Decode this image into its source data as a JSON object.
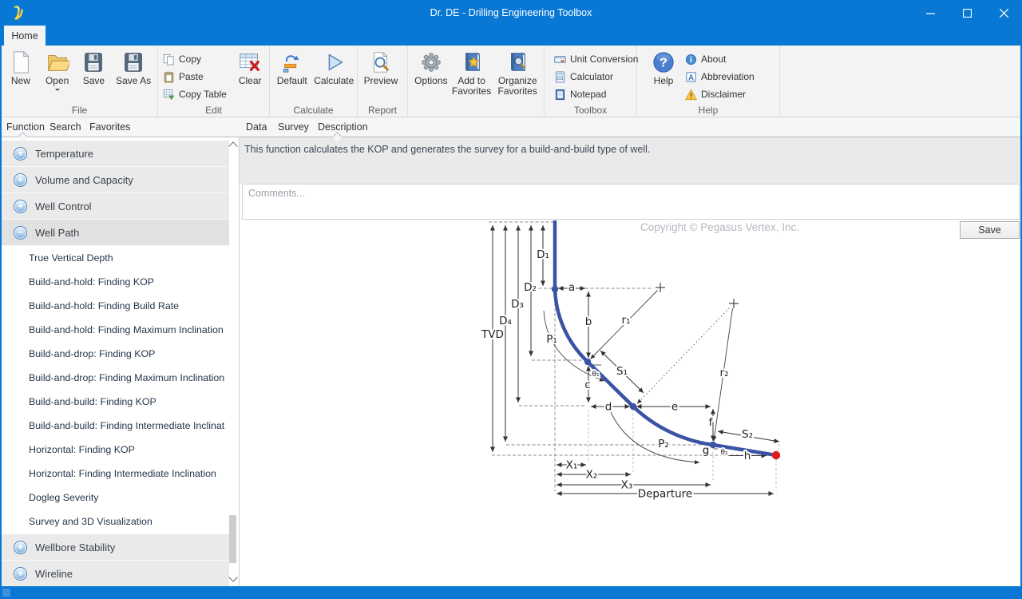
{
  "titlebar": {
    "title": "Dr. DE - Drilling Engineering Toolbox"
  },
  "ribbon": {
    "home_tab": "Home",
    "file": {
      "group": "File",
      "new": "New",
      "open": "Open",
      "save": "Save",
      "save_as": "Save As"
    },
    "edit": {
      "group": "Edit",
      "copy": "Copy",
      "paste": "Paste",
      "copy_table": "Copy Table",
      "clear": "Clear"
    },
    "calc": {
      "group": "Calculate",
      "default": "Default",
      "calculate": "Calculate"
    },
    "report": {
      "group": "Report",
      "preview": "Preview"
    },
    "favorites": {
      "options": "Options",
      "add_to_favorites": "Add to Favorites",
      "organize_favorites": "Organize Favorites"
    },
    "toolbox": {
      "group": "Toolbox",
      "unit_conversion": "Unit Conversion",
      "calculator": "Calculator",
      "notepad": "Notepad"
    },
    "help": {
      "group": "Help",
      "help": "Help",
      "about": "About",
      "abbreviation": "Abbreviation",
      "disclaimer": "Disclaimer"
    }
  },
  "nav_tabs": {
    "function": "Function",
    "search": "Search",
    "favorites": "Favorites",
    "data": "Data",
    "survey": "Survey",
    "description": "Description"
  },
  "sidebar": {
    "categories": [
      "Temperature",
      "Volume and Capacity",
      "Well Control",
      "Well Path",
      "Wellbore Stability",
      "Wireline"
    ],
    "well_path_items": [
      "True Vertical Depth",
      "Build-and-hold: Finding KOP",
      "Build-and-hold: Finding Build Rate",
      "Build-and-hold: Finding Maximum Inclination",
      "Build-and-drop: Finding KOP",
      "Build-and-drop: Finding Maximum Inclination",
      "Build-and-build: Finding KOP",
      "Build-and-build: Finding Intermediate Inclinat",
      "Horizontal: Finding KOP",
      "Horizontal: Finding Intermediate Inclination",
      "Dogleg Severity",
      "Survey and 3D Visualization"
    ]
  },
  "description_panel": {
    "text": "This function calculates the KOP and generates the survey for a build-and-build type of well."
  },
  "comments": {
    "placeholder": "Comments..."
  },
  "canvas": {
    "copyright": "Copyright © Pegasus Vertex, Inc.",
    "save": "Save"
  },
  "diagram": {
    "labels": {
      "tvd": "TVD",
      "d1": "D₁",
      "d2": "D₂",
      "d3": "D₃",
      "d4": "D₄",
      "a": "a",
      "b": "b",
      "c": "c",
      "d": "d",
      "e": "e",
      "f": "f",
      "g": "g",
      "h": "h",
      "r1": "r₁",
      "r2": "r₂",
      "s1": "S₁",
      "s2": "S₂",
      "p1": "P₁",
      "p2": "P₂",
      "theta1": "θ₁",
      "theta2": "θ₂",
      "x1": "X₁",
      "x2": "X₂",
      "x3": "X₃",
      "departure": "Departure"
    },
    "colors": {
      "path": "#3a53a4",
      "end_point": "#e01b1b"
    }
  }
}
